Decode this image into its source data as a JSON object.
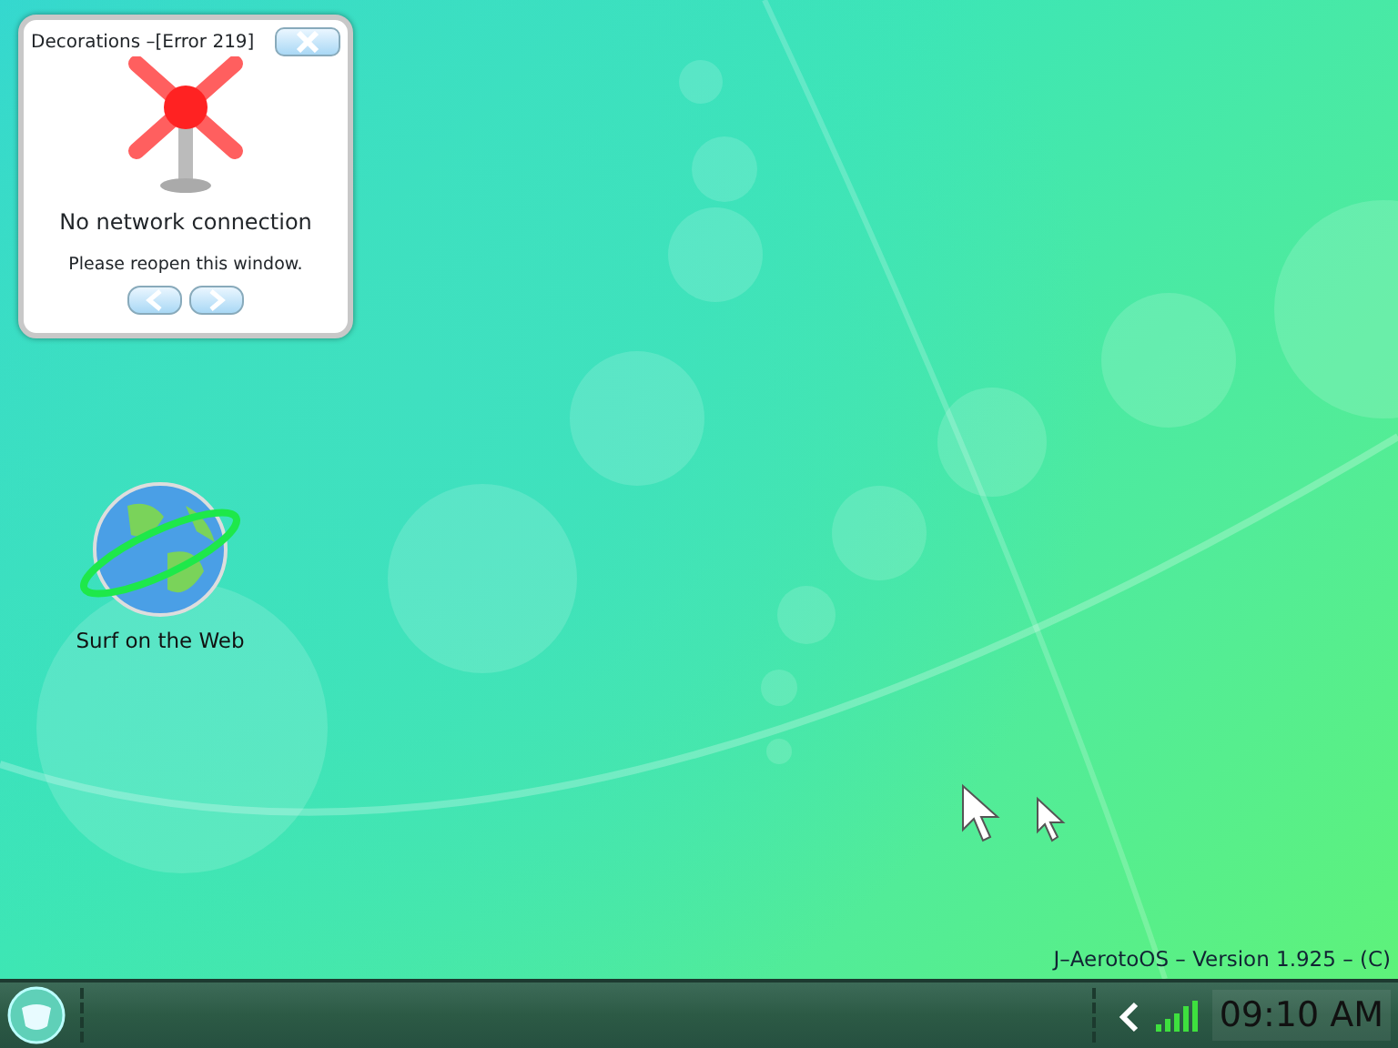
{
  "gadget": {
    "title": "Decorations –[Error 219]",
    "message": "No network connection",
    "hint": "Please reopen this window."
  },
  "desktop_icons": [
    {
      "label": "Surf on the Web"
    }
  ],
  "version_text": "J–AerotoOS – Version 1.925 – (C)",
  "taskbar": {
    "clock": "09:10 AM"
  }
}
